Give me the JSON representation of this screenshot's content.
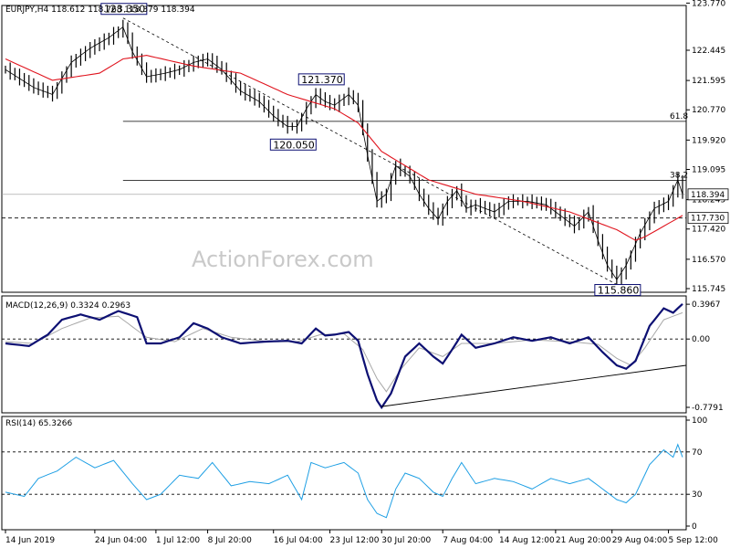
{
  "chart_data": {
    "type": "line",
    "panels": {
      "price": {
        "header": "EURJPY,H4  118.612 118.768 118.379 118.394",
        "ylim": [
          115.745,
          123.6
        ],
        "yticks": [
          "123.770",
          "122.445",
          "121.595",
          "120.770",
          "119.920",
          "119.095",
          "118.245",
          "117.420",
          "116.570",
          "115.745"
        ],
        "last_price": 118.394,
        "last_price_label": "118.394",
        "support_level": 117.73,
        "support_label": "117.730",
        "fib_levels": [
          {
            "label": "61.8",
            "value": 120.445
          },
          {
            "label": "38.2",
            "value": 118.79
          }
        ],
        "annotations": [
          {
            "label": "123.350",
            "value": 123.35
          },
          {
            "label": "121.370",
            "value": 121.37
          },
          {
            "label": "120.050",
            "value": 120.05
          },
          {
            "label": "115.860",
            "value": 115.86
          }
        ],
        "close_keypoints": [
          [
            0,
            121.9
          ],
          [
            6,
            121.4
          ],
          [
            10,
            121.2
          ],
          [
            14,
            122.1
          ],
          [
            18,
            122.5
          ],
          [
            22,
            122.8
          ],
          [
            25,
            123.1
          ],
          [
            27,
            122.4
          ],
          [
            30,
            121.7
          ],
          [
            34,
            121.8
          ],
          [
            37,
            121.9
          ],
          [
            40,
            122.1
          ],
          [
            43,
            122.2
          ],
          [
            46,
            121.9
          ],
          [
            50,
            121.3
          ],
          [
            54,
            121.0
          ],
          [
            57,
            120.6
          ],
          [
            60,
            120.3
          ],
          [
            62,
            120.3
          ],
          [
            64,
            120.8
          ],
          [
            66,
            121.2
          ],
          [
            68,
            121.0
          ],
          [
            70,
            120.9
          ],
          [
            73,
            121.2
          ],
          [
            75,
            120.9
          ],
          [
            77,
            119.5
          ],
          [
            79,
            118.2
          ],
          [
            81,
            118.4
          ],
          [
            83,
            119.2
          ],
          [
            86,
            118.9
          ],
          [
            88,
            118.4
          ],
          [
            90,
            118.0
          ],
          [
            92,
            117.7
          ],
          [
            94,
            118.2
          ],
          [
            96,
            118.5
          ],
          [
            98,
            118.0
          ],
          [
            100,
            118.1
          ],
          [
            104,
            117.9
          ],
          [
            107,
            118.2
          ],
          [
            111,
            118.2
          ],
          [
            115,
            118.1
          ],
          [
            118,
            117.8
          ],
          [
            121,
            117.5
          ],
          [
            124,
            117.9
          ],
          [
            126,
            117.1
          ],
          [
            128,
            116.4
          ],
          [
            130,
            116.0
          ],
          [
            132,
            116.4
          ],
          [
            135,
            117.3
          ],
          [
            138,
            118.0
          ],
          [
            141,
            118.2
          ],
          [
            143,
            118.8
          ],
          [
            144,
            118.4
          ]
        ],
        "ma_keypoints": [
          [
            0,
            122.2
          ],
          [
            10,
            121.6
          ],
          [
            20,
            121.8
          ],
          [
            25,
            122.2
          ],
          [
            30,
            122.3
          ],
          [
            40,
            122.0
          ],
          [
            50,
            121.8
          ],
          [
            60,
            121.2
          ],
          [
            70,
            120.8
          ],
          [
            75,
            120.4
          ],
          [
            80,
            119.6
          ],
          [
            90,
            118.8
          ],
          [
            100,
            118.4
          ],
          [
            110,
            118.2
          ],
          [
            120,
            117.9
          ],
          [
            126,
            117.6
          ],
          [
            130,
            117.4
          ],
          [
            134,
            117.1
          ],
          [
            136,
            117.2
          ],
          [
            140,
            117.5
          ],
          [
            144,
            117.8
          ]
        ],
        "trendline_from": 123.35,
        "trendline_to": 115.86
      },
      "macd": {
        "header": "MACD(12,26,9) 0.3324 0.2963",
        "ylim": [
          -0.8,
          0.45
        ],
        "yticks": [
          "0.3967",
          "0.00",
          "-0.7791"
        ],
        "macd_keypoints": [
          [
            0,
            -0.05
          ],
          [
            5,
            -0.08
          ],
          [
            9,
            0.05
          ],
          [
            12,
            0.22
          ],
          [
            16,
            0.28
          ],
          [
            20,
            0.22
          ],
          [
            24,
            0.32
          ],
          [
            28,
            0.25
          ],
          [
            30,
            -0.05
          ],
          [
            33,
            -0.05
          ],
          [
            37,
            0.02
          ],
          [
            40,
            0.18
          ],
          [
            43,
            0.12
          ],
          [
            46,
            0.02
          ],
          [
            50,
            -0.05
          ],
          [
            55,
            -0.03
          ],
          [
            60,
            -0.02
          ],
          [
            63,
            -0.05
          ],
          [
            66,
            0.12
          ],
          [
            68,
            0.04
          ],
          [
            70,
            0.05
          ],
          [
            73,
            0.08
          ],
          [
            75,
            -0.02
          ],
          [
            77,
            -0.4
          ],
          [
            79,
            -0.7
          ],
          [
            80,
            -0.78
          ],
          [
            82,
            -0.62
          ],
          [
            85,
            -0.2
          ],
          [
            88,
            -0.05
          ],
          [
            91,
            -0.2
          ],
          [
            93,
            -0.28
          ],
          [
            95,
            -0.12
          ],
          [
            97,
            0.05
          ],
          [
            100,
            -0.1
          ],
          [
            104,
            -0.05
          ],
          [
            108,
            0.02
          ],
          [
            112,
            -0.02
          ],
          [
            116,
            0.02
          ],
          [
            120,
            -0.05
          ],
          [
            124,
            0.02
          ],
          [
            127,
            -0.15
          ],
          [
            130,
            -0.3
          ],
          [
            132,
            -0.34
          ],
          [
            134,
            -0.25
          ],
          [
            137,
            0.15
          ],
          [
            140,
            0.35
          ],
          [
            142,
            0.3
          ],
          [
            144,
            0.4
          ]
        ],
        "signal_keypoints": [
          [
            0,
            -0.03
          ],
          [
            6,
            -0.05
          ],
          [
            12,
            0.12
          ],
          [
            18,
            0.24
          ],
          [
            24,
            0.26
          ],
          [
            30,
            0.02
          ],
          [
            36,
            -0.03
          ],
          [
            42,
            0.12
          ],
          [
            48,
            0.02
          ],
          [
            56,
            -0.03
          ],
          [
            62,
            -0.03
          ],
          [
            67,
            0.05
          ],
          [
            72,
            0.06
          ],
          [
            76,
            -0.12
          ],
          [
            79,
            -0.45
          ],
          [
            81,
            -0.6
          ],
          [
            84,
            -0.35
          ],
          [
            88,
            -0.1
          ],
          [
            93,
            -0.2
          ],
          [
            97,
            -0.05
          ],
          [
            104,
            -0.05
          ],
          [
            112,
            -0.01
          ],
          [
            120,
            -0.03
          ],
          [
            126,
            -0.06
          ],
          [
            130,
            -0.22
          ],
          [
            133,
            -0.3
          ],
          [
            136,
            -0.1
          ],
          [
            140,
            0.22
          ],
          [
            144,
            0.3
          ]
        ],
        "trendline_from": -0.77,
        "trendline_to": -0.3
      },
      "rsi": {
        "header": "RSI(14) 65.3266",
        "ylim": [
          0,
          100
        ],
        "yticks": [
          "100",
          "70",
          "30",
          "0"
        ],
        "levels": [
          70,
          30
        ],
        "rsi_keypoints": [
          [
            0,
            32
          ],
          [
            4,
            28
          ],
          [
            7,
            45
          ],
          [
            11,
            52
          ],
          [
            15,
            65
          ],
          [
            19,
            55
          ],
          [
            23,
            62
          ],
          [
            27,
            40
          ],
          [
            30,
            25
          ],
          [
            33,
            30
          ],
          [
            37,
            48
          ],
          [
            41,
            45
          ],
          [
            44,
            60
          ],
          [
            48,
            38
          ],
          [
            52,
            42
          ],
          [
            56,
            40
          ],
          [
            60,
            48
          ],
          [
            63,
            25
          ],
          [
            65,
            60
          ],
          [
            68,
            55
          ],
          [
            72,
            60
          ],
          [
            75,
            50
          ],
          [
            77,
            25
          ],
          [
            79,
            12
          ],
          [
            81,
            8
          ],
          [
            83,
            35
          ],
          [
            85,
            50
          ],
          [
            88,
            45
          ],
          [
            91,
            32
          ],
          [
            93,
            28
          ],
          [
            95,
            45
          ],
          [
            97,
            60
          ],
          [
            100,
            40
          ],
          [
            104,
            45
          ],
          [
            108,
            42
          ],
          [
            112,
            35
          ],
          [
            116,
            45
          ],
          [
            120,
            40
          ],
          [
            124,
            45
          ],
          [
            127,
            35
          ],
          [
            130,
            25
          ],
          [
            132,
            22
          ],
          [
            134,
            30
          ],
          [
            137,
            58
          ],
          [
            140,
            72
          ],
          [
            142,
            65
          ],
          [
            143,
            77
          ],
          [
            144,
            65
          ]
        ]
      }
    },
    "x_labels": [
      "14 Jun 2019",
      "24 Jun 04:00",
      "1 Jul 12:00",
      "8 Jul 20:00",
      "16 Jul 04:00",
      "23 Jul 12:00",
      "30 Jul 20:00",
      "7 Aug 04:00",
      "14 Aug 12:00",
      "21 Aug 20:00",
      "29 Aug 04:00",
      "5 Sep 12:00"
    ],
    "x_label_index": [
      0,
      19,
      32,
      43,
      57,
      69,
      80,
      93,
      105,
      117,
      129,
      141
    ],
    "n_bars": 145,
    "watermark": "ActionForex.com",
    "colors": {
      "price": "#000000",
      "ma": "#e0141e",
      "macd": "#0d1073",
      "signal": "#a8a8a8",
      "rsi": "#1e9fe4",
      "grid": "#000000",
      "background": "#ffffff"
    }
  }
}
